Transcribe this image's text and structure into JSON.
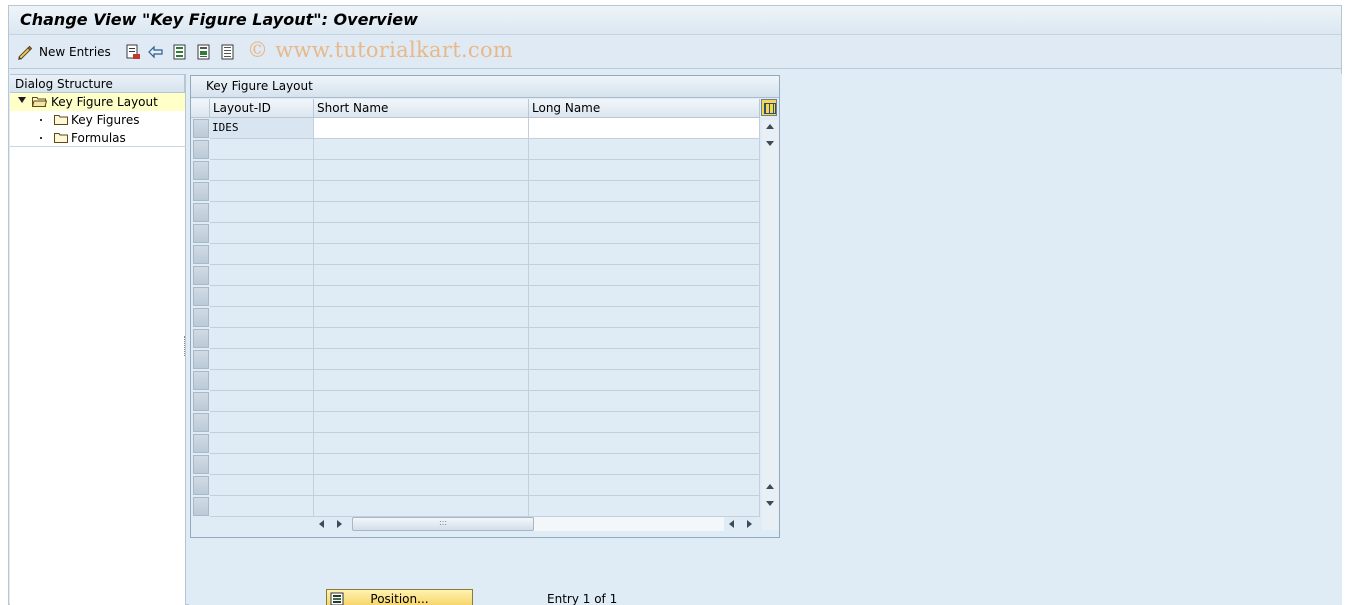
{
  "window": {
    "title": "Change View \"Key Figure Layout\": Overview"
  },
  "toolbar": {
    "new_entries_label": "New Entries",
    "icons": [
      "edit-pencil-icon",
      "copy-as-icon",
      "undo-change-icon",
      "select-all-icon",
      "select-block-icon",
      "deselect-all-icon"
    ],
    "watermark": "© www.tutorialkart.com"
  },
  "dialog_structure": {
    "header": "Dialog Structure",
    "items": [
      {
        "label": "Key Figure Layout",
        "level": 0,
        "expanded": true,
        "selected": true
      },
      {
        "label": "Key Figures",
        "level": 1,
        "selected": false
      },
      {
        "label": "Formulas",
        "level": 1,
        "selected": false
      }
    ]
  },
  "table": {
    "title": "Key Figure Layout",
    "columns": [
      "Layout-ID",
      "Short Name",
      "Long Name"
    ],
    "rows": [
      [
        "IDES",
        "",
        ""
      ]
    ],
    "visible_row_count": 19
  },
  "footer": {
    "position_button_label": "Position...",
    "entry_info": "Entry 1 of 1"
  },
  "colors": {
    "background": "#dfebf5",
    "selected_tree": "#ffffc8",
    "button": "#f4cf5a"
  }
}
